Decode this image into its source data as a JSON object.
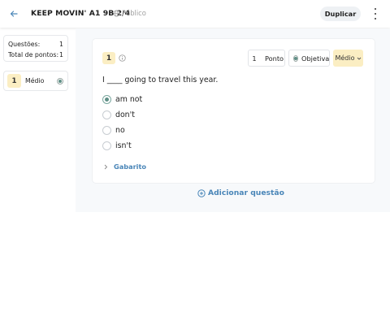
{
  "header": {
    "back_icon": "arrow-left-icon",
    "title": "KEEP MOVIN' A1 9B 2/4",
    "visibility_icon": "globe-icon",
    "visibility_label": "Público",
    "duplicate_label": "Duplicar",
    "menu_icon": "kebab-menu-icon"
  },
  "summary": {
    "questions_label": "Questões:",
    "questions_value": "1",
    "points_label": "Total de pontos:",
    "points_value": "1"
  },
  "question_nav": [
    {
      "number": "1",
      "level": "Médio",
      "status_icon": "radio-status-icon"
    }
  ],
  "question": {
    "number": "1",
    "info_icon": "info-icon",
    "points_value": "1",
    "points_label": "Ponto",
    "type_label": "Objetiva",
    "level_label": "Médio",
    "level_icon": "chevron-down-icon",
    "prompt": "I ____ going to travel this year.",
    "options": [
      {
        "text": "am not",
        "selected": true
      },
      {
        "text": "don't",
        "selected": false
      },
      {
        "text": "no",
        "selected": false
      },
      {
        "text": "isn't",
        "selected": false
      }
    ],
    "answer_key_label": "Gabarito",
    "answer_key_icon": "chevron-right-icon"
  },
  "add_question_label": "Adicionar questão",
  "add_question_icon": "plus-circle-icon",
  "colors": {
    "accent_blue": "#4a86b8",
    "level_yellow": "#fbeec3",
    "selected_green": "#5f8f86"
  }
}
